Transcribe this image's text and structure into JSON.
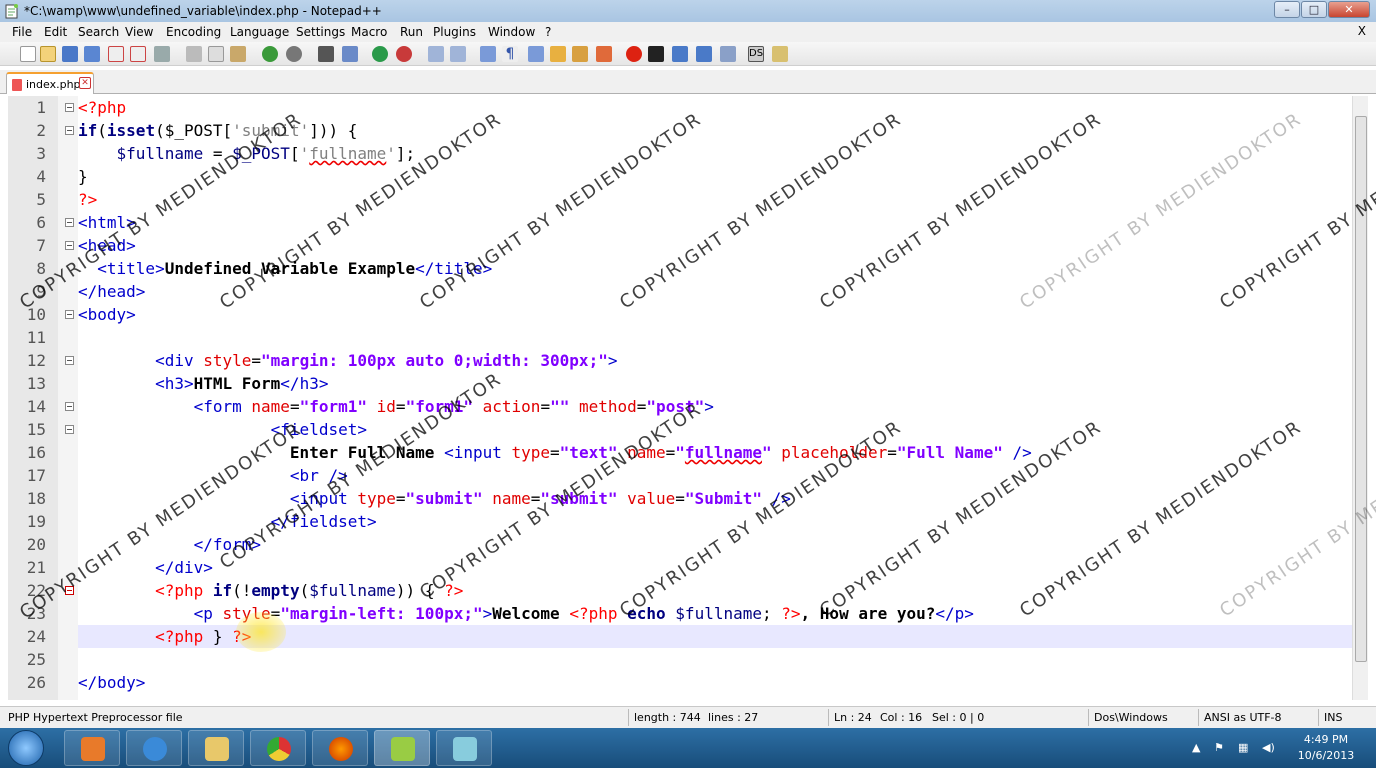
{
  "window": {
    "title": "*C:\\wamp\\www\\undefined_variable\\index.php - Notepad++",
    "controls": {
      "minimize": "–",
      "maximize": "□",
      "close": "✕"
    }
  },
  "menubar": {
    "items": [
      "File",
      "Edit",
      "Search",
      "View",
      "Encoding",
      "Language",
      "Settings",
      "Macro",
      "Run",
      "Plugins",
      "Window",
      "?"
    ],
    "close_label": "X"
  },
  "tabs": [
    {
      "label": "index.php",
      "close": "✕"
    }
  ],
  "editor": {
    "current_line": 24,
    "lines": [
      {
        "n": "1"
      },
      {
        "n": "2"
      },
      {
        "n": "3"
      },
      {
        "n": "4"
      },
      {
        "n": "5"
      },
      {
        "n": "6"
      },
      {
        "n": "7"
      },
      {
        "n": "8"
      },
      {
        "n": "9"
      },
      {
        "n": "10"
      },
      {
        "n": "11"
      },
      {
        "n": "12"
      },
      {
        "n": "13"
      },
      {
        "n": "14"
      },
      {
        "n": "15"
      },
      {
        "n": "16"
      },
      {
        "n": "17"
      },
      {
        "n": "18"
      },
      {
        "n": "19"
      },
      {
        "n": "20"
      },
      {
        "n": "21"
      },
      {
        "n": "22"
      },
      {
        "n": "23"
      },
      {
        "n": "24"
      },
      {
        "n": "25"
      },
      {
        "n": "26"
      }
    ]
  },
  "statusbar": {
    "file_type": "PHP Hypertext Preprocessor file",
    "length": "length : 744",
    "lines": "lines : 27",
    "ln": "Ln : 24",
    "col": "Col : 16",
    "sel": "Sel : 0 | 0",
    "eol": "Dos\\Windows",
    "encoding": "ANSI as UTF-8",
    "mode": "INS"
  },
  "taskbar": {
    "time": "4:49 PM",
    "date": "10/6/2013"
  },
  "watermark": {
    "text": "COPYRIGHT BY MEDIENDOKTOR"
  }
}
